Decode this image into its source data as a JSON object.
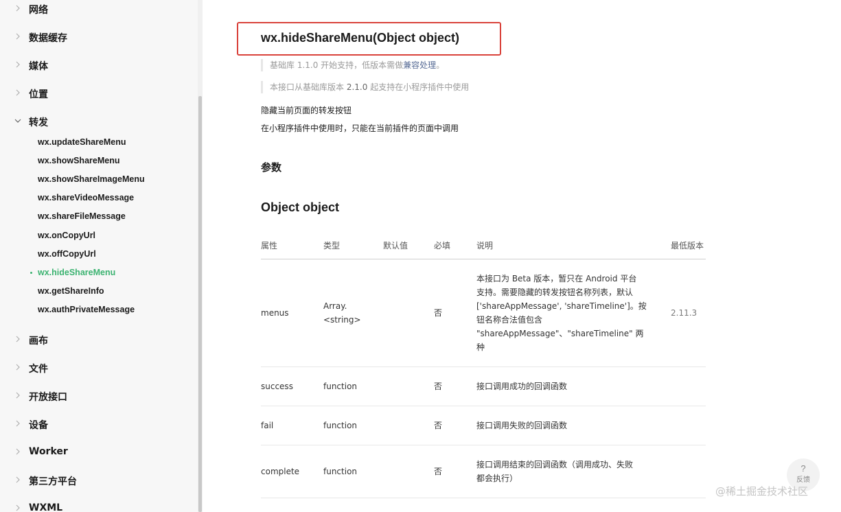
{
  "sidebar": {
    "categories_top": [
      {
        "label": "网络"
      },
      {
        "label": "数据缓存"
      },
      {
        "label": "媒体"
      },
      {
        "label": "位置"
      }
    ],
    "expanded": {
      "label": "转发",
      "items": [
        {
          "label": "wx.updateShareMenu"
        },
        {
          "label": "wx.showShareMenu"
        },
        {
          "label": "wx.showShareImageMenu"
        },
        {
          "label": "wx.shareVideoMessage"
        },
        {
          "label": "wx.shareFileMessage"
        },
        {
          "label": "wx.onCopyUrl"
        },
        {
          "label": "wx.offCopyUrl"
        },
        {
          "label": "wx.hideShareMenu",
          "active": true
        },
        {
          "label": "wx.getShareInfo"
        },
        {
          "label": "wx.authPrivateMessage"
        }
      ]
    },
    "categories_bottom": [
      {
        "label": "画布"
      },
      {
        "label": "文件"
      },
      {
        "label": "开放接口"
      },
      {
        "label": "设备"
      },
      {
        "label": "Worker"
      },
      {
        "label": "第三方平台"
      },
      {
        "label": "WXML"
      }
    ]
  },
  "main": {
    "title": "wx.hideShareMenu(Object object)",
    "note1_prefix": "基础库 1.1.0 开始支持，低版本需做",
    "note1_link": "兼容处理",
    "note1_suffix": "。",
    "note2_prefix": "本接口从基础库版本 ",
    "note2_version": "2.1.0",
    "note2_suffix": " 起支持在小程序插件中使用",
    "desc1": "隐藏当前页面的转发按钮",
    "desc2": "在小程序插件中使用时，只能在当前插件的页面中调用",
    "params_heading": "参数",
    "object_heading": "Object object",
    "table": {
      "headers": [
        "属性",
        "类型",
        "默认值",
        "必填",
        "说明",
        "最低版本"
      ],
      "rows": [
        {
          "name": "menus",
          "type_line1": "Array.",
          "type_line2": "<string>",
          "default": "",
          "required": "否",
          "desc_lines": [
            "本接口为 Beta 版本，暂只在 Android 平台",
            "支持。需要隐藏的转发按钮名称列表，默认",
            "['shareAppMessage', 'shareTimeline']。按",
            "钮名称合法值包含",
            "\"shareAppMessage\"、\"shareTimeline\" 两",
            "种"
          ],
          "version": "2.11.3"
        },
        {
          "name": "success",
          "type_line1": "function",
          "default": "",
          "required": "否",
          "desc_lines": [
            "接口调用成功的回调函数"
          ],
          "version": ""
        },
        {
          "name": "fail",
          "type_line1": "function",
          "default": "",
          "required": "否",
          "desc_lines": [
            "接口调用失败的回调函数"
          ],
          "version": ""
        },
        {
          "name": "complete",
          "type_line1": "function",
          "default": "",
          "required": "否",
          "desc_lines": [
            "接口调用结束的回调函数（调用成功、失败",
            "都会执行）"
          ],
          "version": ""
        }
      ]
    }
  },
  "feedback": {
    "icon": "?",
    "label": "反馈"
  },
  "watermark": "@稀土掘金技术社区",
  "colors": {
    "active": "#3cb371",
    "highlight_border": "#d9413a",
    "link": "#576b95"
  }
}
